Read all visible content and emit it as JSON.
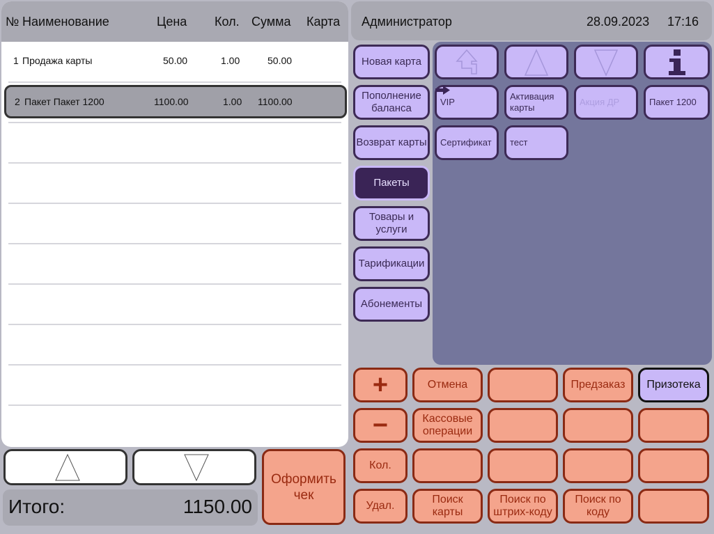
{
  "receipt": {
    "columns": {
      "number": "№",
      "name": "Наименование",
      "price": "Цена",
      "qty": "Кол.",
      "sum": "Сумма",
      "card": "Карта"
    },
    "rows": [
      {
        "number": "1",
        "name": "Продажа карты",
        "price": "50.00",
        "qty": "1.00",
        "sum": "50.00",
        "card": ""
      },
      {
        "number": "2",
        "name": "Пакет Пакет 1200",
        "price": "1100.00",
        "qty": "1.00",
        "sum": "1100.00",
        "card": ""
      }
    ],
    "selected_row": 2
  },
  "total": {
    "label": "Итого:",
    "value": "1150.00"
  },
  "checkout": {
    "label": "Оформить чек"
  },
  "header": {
    "user": "Администратор",
    "date": "28.09.2023",
    "time": "17:16"
  },
  "categories": [
    {
      "label": "Новая карта",
      "active": false
    },
    {
      "label": "Пополнение баланса",
      "active": false
    },
    {
      "label": "Возврат карты",
      "active": false
    },
    {
      "label": "Пакеты",
      "active": true
    },
    {
      "label": "Товары и услуги",
      "active": false
    },
    {
      "label": "Тарификации",
      "active": false
    },
    {
      "label": "Абонементы",
      "active": false
    }
  ],
  "products": {
    "nav_icons": [
      "back-up-arrow-icon",
      "up-triangle-icon",
      "down-triangle-icon",
      "info-icon"
    ],
    "items": [
      {
        "label": "VIP",
        "enabled": true
      },
      {
        "label": "Активация карты",
        "enabled": true
      },
      {
        "label": "Акция ДР",
        "enabled": false
      },
      {
        "label": "Пакет 1200",
        "enabled": true
      },
      {
        "label": "Сертификат",
        "enabled": true
      },
      {
        "label": "тест",
        "enabled": true
      }
    ]
  },
  "keypad": {
    "plus": "+",
    "minus": "−",
    "cancel": "Отмена",
    "preorder": "Предзаказ",
    "card_archive": "Призотека",
    "cash_operations": "Кассовые операции",
    "qty": "Кол.",
    "delete": "Удал.",
    "find_card": "Поиск карты",
    "find_barcode": "Поиск по штрих-коду",
    "find_code": "Поиск по коду"
  },
  "colors": {
    "purple_button": "#c9b8f8",
    "purple_active": "#3a2456",
    "salmon_button": "#f4a48c",
    "panel_slate": "#74769c",
    "header_gray": "#a9a9b2"
  }
}
